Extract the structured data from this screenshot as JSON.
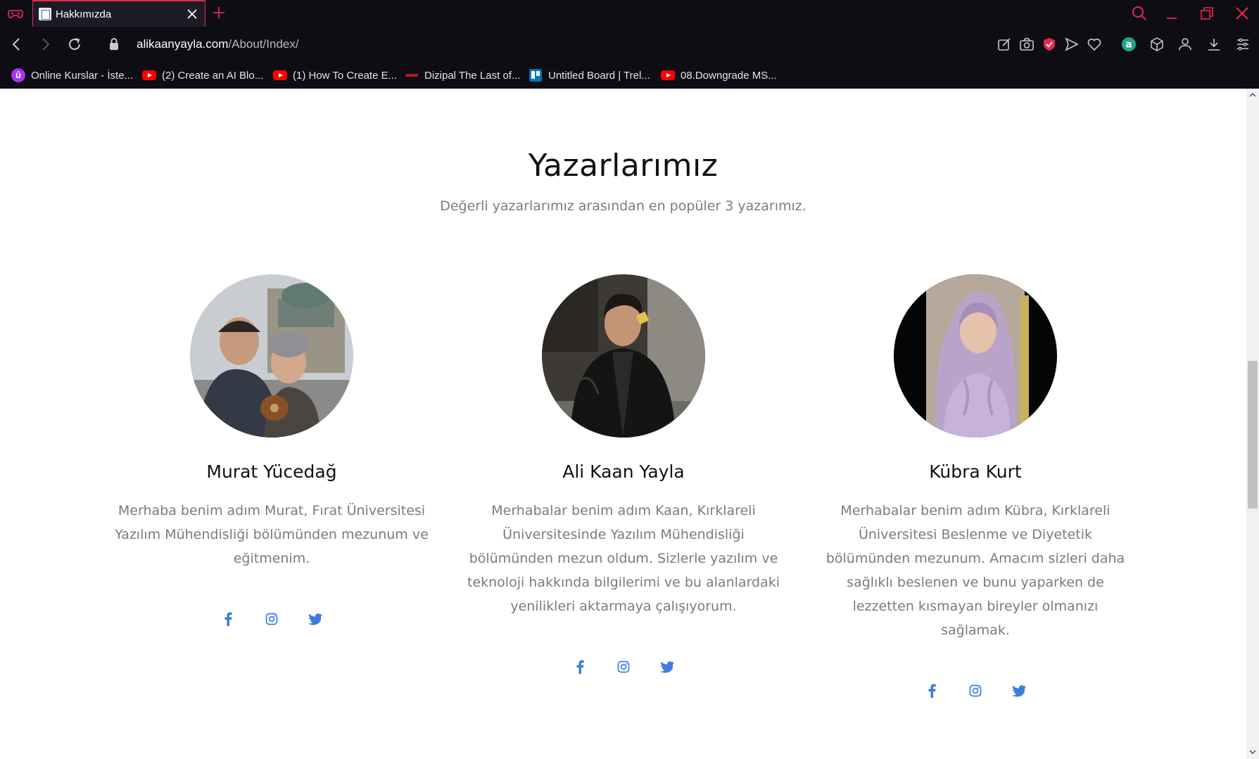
{
  "browser": {
    "tab": {
      "title": "Hakkımızda",
      "favicon": "page-icon"
    },
    "url": {
      "host": "alikaanyayla.com",
      "path": "/About/Index/"
    },
    "bookmarks": [
      {
        "label": "Online Kurslar - İste...",
        "icon": "udemy-icon"
      },
      {
        "label": "(2) Create an AI Blo...",
        "icon": "youtube-icon"
      },
      {
        "label": "(1) How To Create E...",
        "icon": "youtube-icon"
      },
      {
        "label": "Dizipal The Last of...",
        "icon": "dizipal-icon"
      },
      {
        "label": "Untitled Board | Trel...",
        "icon": "trello-icon"
      },
      {
        "label": "08.Downgrade MS...",
        "icon": "youtube-icon"
      }
    ],
    "accent_color": "#e8264f"
  },
  "section": {
    "title": "Yazarlarımız",
    "subtitle": "Değerli yazarlarımız arasından en popüler 3 yazarımız."
  },
  "authors": [
    {
      "name": "Murat Yücedağ",
      "bio": "Merhaba benim adım Murat, Fırat Üniversitesi Yazılım Mühendisliği bölümünden mezunum ve eğitmenim.",
      "photo": "couple-photo"
    },
    {
      "name": "Ali Kaan Yayla",
      "bio": "Merhabalar benim adım Kaan, Kırklareli Üniversitesinde Yazılım Mühendisliği bölümünden mezun oldum. Sizlerle yazılım ve teknoloji hakkında bilgilerimi ve bu alanlardaki yenilikleri aktarmaya çalışıyorum.",
      "photo": "man-leather-jacket-photo"
    },
    {
      "name": "Kübra Kurt",
      "bio": "Merhabalar benim adım Kübra, Kırklareli Üniversitesi Beslenme ve Diyetetik bölümünden mezunum. Amacım sizleri daha sağlıklı beslenen ve bunu yaparken de lezzetten kısmayan bireyler olmanızı sağlamak.",
      "photo": "woman-hijab-photo"
    }
  ],
  "social_icons": [
    "facebook-icon",
    "instagram-icon",
    "twitter-icon"
  ],
  "social_color": "#3b7ddd"
}
